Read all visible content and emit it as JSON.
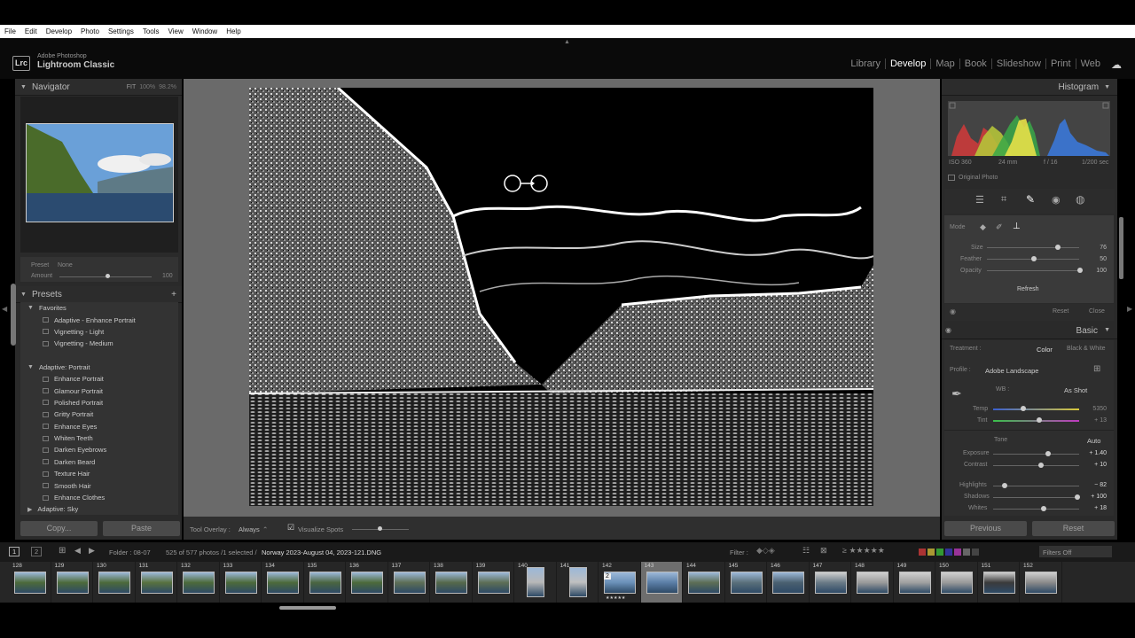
{
  "menu": [
    "File",
    "Edit",
    "Develop",
    "Photo",
    "Settings",
    "Tools",
    "View",
    "Window",
    "Help"
  ],
  "brand": {
    "logo": "Lrc",
    "line1": "Adobe Photoshop",
    "line2": "Lightroom Classic"
  },
  "modules": [
    "Library",
    "Develop",
    "Map",
    "Book",
    "Slideshow",
    "Print",
    "Web"
  ],
  "navigator": {
    "title": "Navigator",
    "fit": "FIT",
    "z1": "100%",
    "z2": "98.2%"
  },
  "preset_amount": {
    "preset_label": "Preset",
    "preset_value": "None",
    "amount_label": "Amount",
    "amount_value": "100"
  },
  "presets": {
    "title": "Presets",
    "add": "+",
    "groups": [
      {
        "name": "Favorites",
        "items": [
          "Adaptive - Enhance Portrait",
          "Vignetting - Light",
          "Vignetting - Medium"
        ]
      },
      {
        "name": "Adaptive: Portrait",
        "items": [
          "Enhance Portrait",
          "Glamour Portrait",
          "Polished Portrait",
          "Gritty Portrait",
          "Enhance Eyes",
          "Whiten Teeth",
          "Darken Eyebrows",
          "Darken Beard",
          "Texture Hair",
          "Smooth Hair",
          "Enhance Clothes"
        ]
      },
      {
        "name": "Adaptive: Sky",
        "items": []
      }
    ]
  },
  "left_buttons": {
    "copy": "Copy...",
    "paste": "Paste"
  },
  "toolbar": {
    "overlay_label": "Tool Overlay :",
    "overlay_value": "Always",
    "visualize": "Visualize Spots"
  },
  "histogram": {
    "title": "Histogram",
    "iso": "ISO 360",
    "focal": "24 mm",
    "aperture": "f / 16",
    "shutter": "1/200 sec",
    "original": "Original Photo"
  },
  "heal": {
    "mode": "Mode",
    "size_label": "Size",
    "size": "76",
    "feather_label": "Feather",
    "feather": "50",
    "opacity_label": "Opacity",
    "opacity": "100",
    "refresh": "Refresh",
    "reset": "Reset",
    "close": "Close",
    "size_pct": 0.76,
    "feather_pct": 0.5,
    "opacity_pct": 1.0
  },
  "basic": {
    "title": "Basic",
    "treatment_label": "Treatment :",
    "color": "Color",
    "bw": "Black & White",
    "profile_label": "Profile :",
    "profile": "Adobe Landscape",
    "wb_label": "WB :",
    "wb": "As Shot",
    "temp_label": "Temp",
    "temp": "5350",
    "tint_label": "Tint",
    "tint": "+ 13",
    "tone": "Tone",
    "auto": "Auto",
    "exposure_label": "Exposure",
    "exposure": "+ 1.40",
    "contrast_label": "Contrast",
    "contrast": "+ 10",
    "highlights_label": "Highlights",
    "highlights": "− 82",
    "shadows_label": "Shadows",
    "shadows": "+ 100",
    "whites_label": "Whites",
    "whites": "+ 18"
  },
  "right_buttons": {
    "previous": "Previous",
    "reset": "Reset"
  },
  "filmbar": {
    "page1": "1",
    "page2": "2",
    "folder": "Folder : 08-07",
    "count": "525 of 577 photos /1 selected /",
    "file": "Norway 2023-August 04, 2023-121.DNG",
    "filter": "Filter :",
    "filters_off": "Filters Off"
  },
  "film_numbers": [
    "128",
    "129",
    "130",
    "131",
    "132",
    "133",
    "134",
    "135",
    "136",
    "137",
    "138",
    "139",
    "140",
    "141",
    "142",
    "143",
    "144",
    "145",
    "146",
    "147",
    "148",
    "149",
    "150",
    "151",
    "152"
  ],
  "badge": "2",
  "colors": {
    "accent_bg": "#2a2a2a",
    "active_text": "#ffffff"
  }
}
